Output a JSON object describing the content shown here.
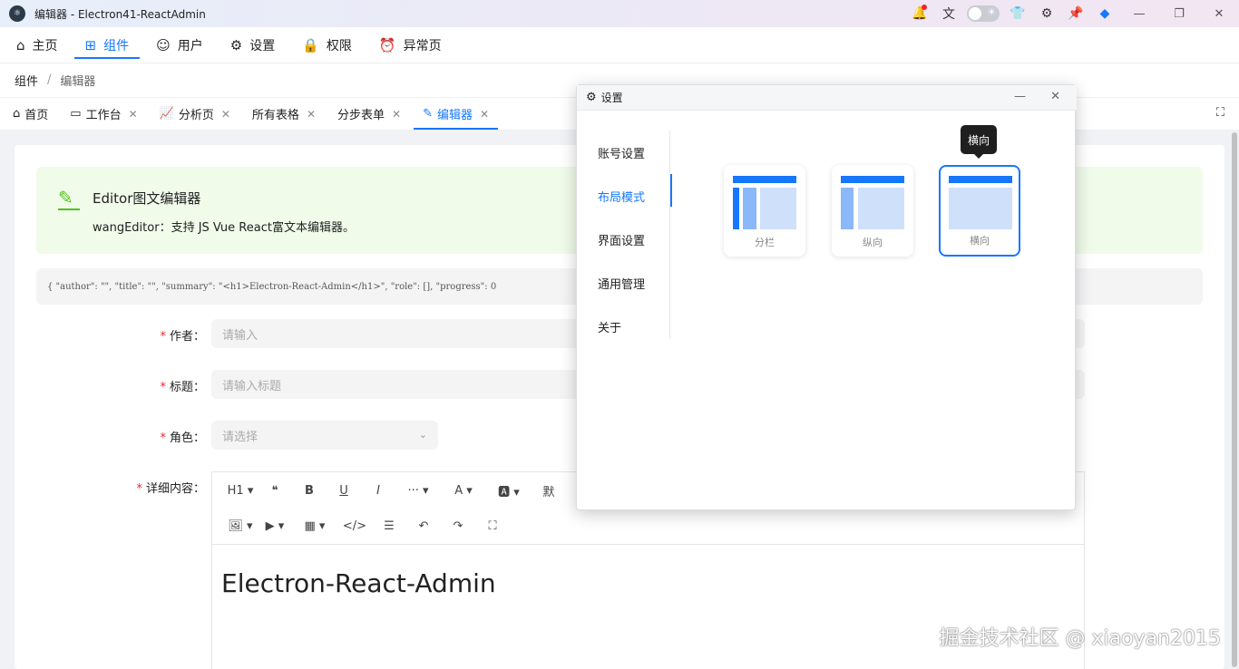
{
  "window": {
    "title": "编辑器 - Electron41-ReactAdmin"
  },
  "titlebar_icons": [
    "bell-icon",
    "translate-icon",
    "theme-toggle",
    "shirt-icon",
    "gear-icon",
    "pin-icon",
    "brand-icon"
  ],
  "nav": [
    {
      "label": "主页",
      "icon": "home-icon",
      "active": false
    },
    {
      "label": "组件",
      "icon": "grid-icon",
      "active": true
    },
    {
      "label": "用户",
      "icon": "user-icon",
      "active": false
    },
    {
      "label": "设置",
      "icon": "gear-icon",
      "active": false
    },
    {
      "label": "权限",
      "icon": "lock-icon",
      "active": false
    },
    {
      "label": "异常页",
      "icon": "alarm-icon",
      "active": false
    }
  ],
  "breadcrumb": {
    "parent": "组件",
    "separator": "/",
    "current": "编辑器"
  },
  "tabs": [
    {
      "label": "首页",
      "closable": false
    },
    {
      "label": "工作台",
      "closable": true
    },
    {
      "label": "分析页",
      "closable": true
    },
    {
      "label": "所有表格",
      "closable": true
    },
    {
      "label": "分步表单",
      "closable": true
    },
    {
      "label": "编辑器",
      "closable": true,
      "active": true
    }
  ],
  "alert": {
    "title": "Editor图文编辑器",
    "description": "wangEditor：支持 JS Vue React富文本编辑器。"
  },
  "json_preview": "{ \"author\": \"\", \"title\": \"\", \"summary\": \"<h1>Electron-React-Admin</h1>\", \"role\": [], \"progress\": 0",
  "form": {
    "author": {
      "label": "作者",
      "placeholder": "请输入"
    },
    "title": {
      "label": "标题",
      "placeholder": "请输入标题"
    },
    "role": {
      "label": "角色",
      "placeholder": "请选择"
    },
    "content": {
      "label": "详细内容"
    }
  },
  "editor": {
    "toolbar_row1": [
      "H1 ▾",
      "❝",
      "B",
      "U",
      "I",
      "··· ▾",
      "A ▾",
      "🅰 ▾",
      "默"
    ],
    "toolbar_row2": [
      "🖼 ▾",
      "▶ ▾",
      "▦ ▾",
      "</>",
      "☰",
      "↶",
      "↷",
      "⛶"
    ],
    "heading": "Electron-React-Admin"
  },
  "settings_dialog": {
    "title": "设置",
    "menu": [
      {
        "label": "账号设置",
        "active": false
      },
      {
        "label": "布局模式",
        "active": true
      },
      {
        "label": "界面设置",
        "active": false
      },
      {
        "label": "通用管理",
        "active": false
      },
      {
        "label": "关于",
        "active": false
      }
    ],
    "layouts": [
      {
        "caption": "分栏",
        "selected": false
      },
      {
        "caption": "纵向",
        "selected": false
      },
      {
        "caption": "横向",
        "selected": true
      }
    ],
    "tooltip": "横向"
  },
  "watermark": "掘金技术社区 @ xiaoyan2015",
  "colors": {
    "accent": "#1677ff",
    "success": "#52c41a",
    "required": "#f5222d"
  }
}
